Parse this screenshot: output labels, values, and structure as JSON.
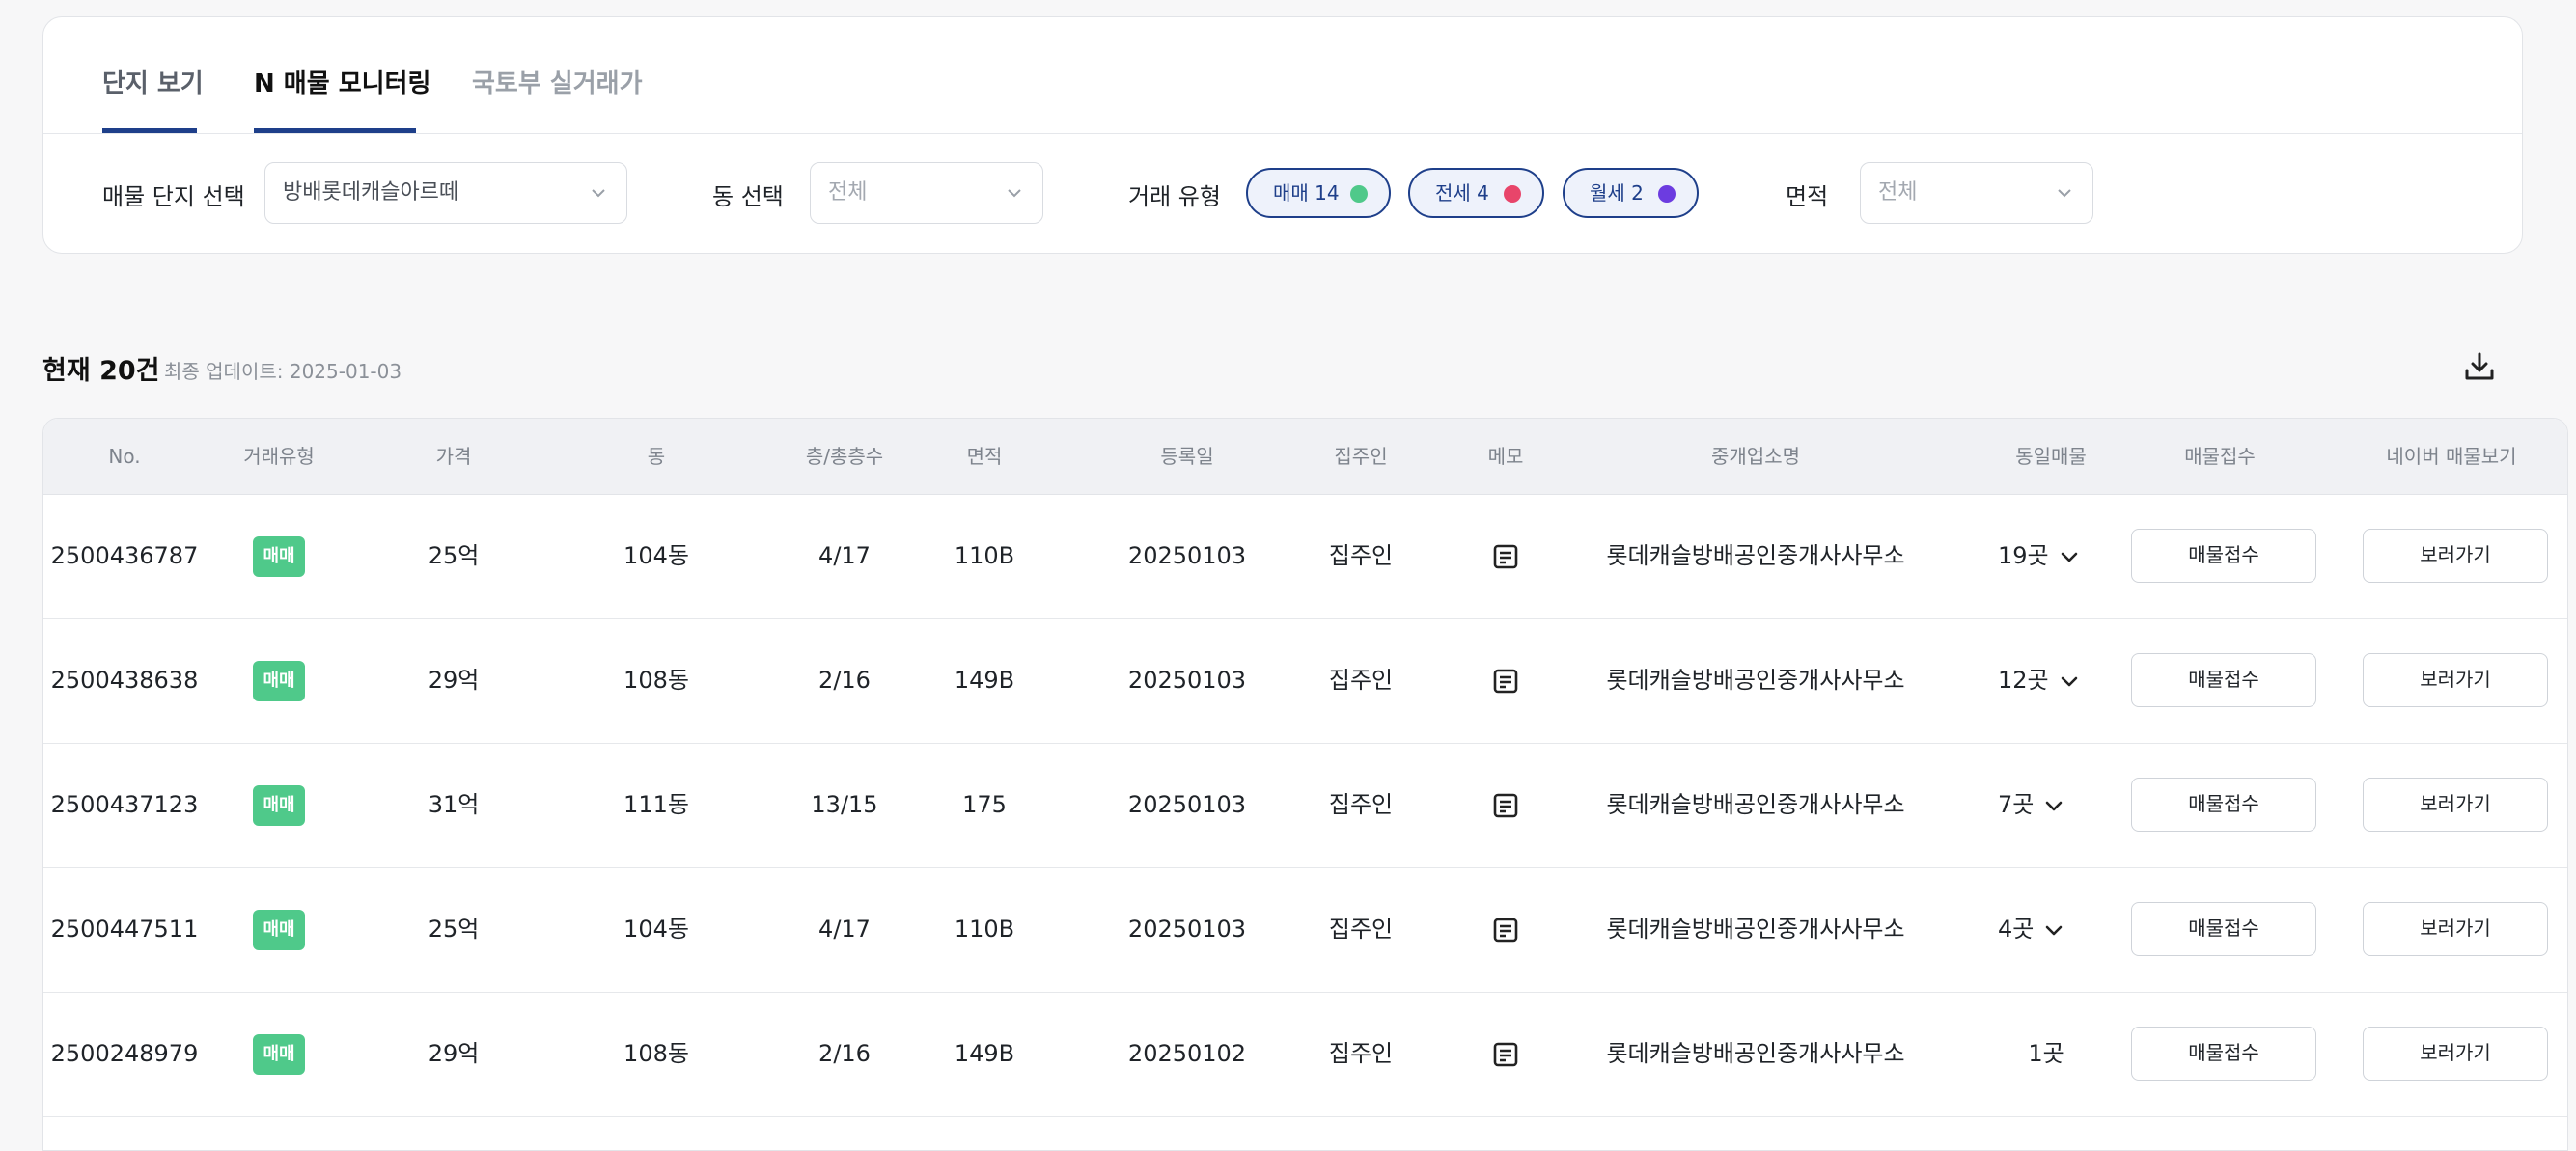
{
  "tabs": [
    {
      "label": "단지 보기",
      "active": false
    },
    {
      "label": "N 매물 모니터링",
      "active": true
    },
    {
      "label": "국토부 실거래가",
      "active": false
    }
  ],
  "filters": {
    "complex_label": "매물 단지 선택",
    "complex_value": "방배롯데캐슬아르떼",
    "dong_label": "동 선택",
    "dong_placeholder": "전체",
    "trade_type_label": "거래 유형",
    "trade_types": [
      {
        "label": "매매 14",
        "color": "#4fc98a"
      },
      {
        "label": "전세 4",
        "color": "#e8456a"
      },
      {
        "label": "월세 2",
        "color": "#6c3ce0"
      }
    ],
    "area_label": "면적",
    "area_placeholder": "전체"
  },
  "summary": {
    "count": "현재 20건",
    "updated": "최종 업데이트: 2025-01-03"
  },
  "table": {
    "headers": [
      "No.",
      "거래유형",
      "가격",
      "동",
      "층/총층수",
      "면적",
      "등록일",
      "집주인",
      "메모",
      "중개업소명",
      "동일매물",
      "매물접수",
      "네이버 매물보기"
    ],
    "receive_button": "매물접수",
    "view_button": "보러가기",
    "rows": [
      {
        "no": "2500436787",
        "type": "매매",
        "price": "25억",
        "dong": "104동",
        "floor": "4/17",
        "area": "110B",
        "date": "20250103",
        "owner": "집주인",
        "agency": "롯데캐슬방배공인중개사사무소",
        "same": "19곳",
        "expandable": true
      },
      {
        "no": "2500438638",
        "type": "매매",
        "price": "29억",
        "dong": "108동",
        "floor": "2/16",
        "area": "149B",
        "date": "20250103",
        "owner": "집주인",
        "agency": "롯데캐슬방배공인중개사사무소",
        "same": "12곳",
        "expandable": true
      },
      {
        "no": "2500437123",
        "type": "매매",
        "price": "31억",
        "dong": "111동",
        "floor": "13/15",
        "area": "175",
        "date": "20250103",
        "owner": "집주인",
        "agency": "롯데캐슬방배공인중개사사무소",
        "same": "7곳",
        "expandable": true
      },
      {
        "no": "2500447511",
        "type": "매매",
        "price": "25억",
        "dong": "104동",
        "floor": "4/17",
        "area": "110B",
        "date": "20250103",
        "owner": "집주인",
        "agency": "롯데캐슬방배공인중개사사무소",
        "same": "4곳",
        "expandable": true
      },
      {
        "no": "2500248979",
        "type": "매매",
        "price": "29억",
        "dong": "108동",
        "floor": "2/16",
        "area": "149B",
        "date": "20250102",
        "owner": "집주인",
        "agency": "롯데캐슬방배공인중개사사무소",
        "same": "1곳",
        "expandable": false
      }
    ]
  }
}
